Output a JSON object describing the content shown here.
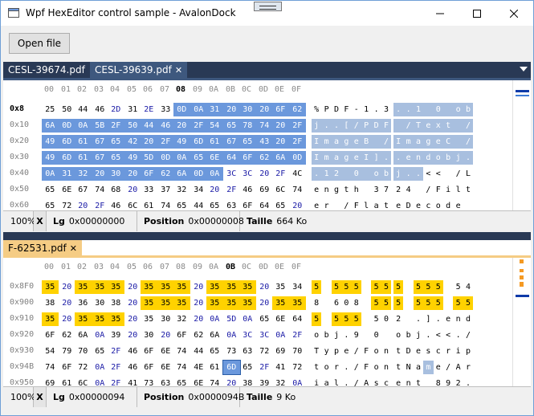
{
  "window": {
    "title": "Wpf HexEditor control sample - AvalonDock"
  },
  "toolbar": {
    "open_label": "Open file"
  },
  "top_pane": {
    "tabs": [
      {
        "label": "CESL-39674.pdf",
        "active": false
      },
      {
        "label": "CESL-39639.pdf",
        "active": true,
        "close": "✕"
      }
    ],
    "header_bytes": [
      "00",
      "01",
      "02",
      "03",
      "04",
      "05",
      "06",
      "07",
      "08",
      "09",
      "0A",
      "0B",
      "0C",
      "0D",
      "0E",
      "0F"
    ],
    "highlight_col": 8,
    "rows": [
      {
        "offset": "0x8",
        "bytes": [
          "25",
          "50",
          "44",
          "46",
          "2D",
          "31",
          "2E",
          "33",
          "0D",
          "0A",
          "31",
          "20",
          "30",
          "20",
          "6F",
          "62"
        ],
        "chars": [
          "%",
          "P",
          "D",
          "F",
          "-",
          "1",
          ".",
          "3",
          ".",
          ".",
          "1",
          " ",
          "0",
          " ",
          "o",
          "b"
        ]
      },
      {
        "offset": "0x10",
        "bytes": [
          "6A",
          "0D",
          "0A",
          "5B",
          "2F",
          "50",
          "44",
          "46",
          "20",
          "2F",
          "54",
          "65",
          "78",
          "74",
          "20",
          "2F"
        ],
        "chars": [
          "j",
          ".",
          ".",
          "[",
          "/",
          "P",
          "D",
          "F",
          " ",
          "/",
          "T",
          "e",
          "x",
          "t",
          " ",
          "/"
        ]
      },
      {
        "offset": "0x20",
        "bytes": [
          "49",
          "6D",
          "61",
          "67",
          "65",
          "42",
          "20",
          "2F",
          "49",
          "6D",
          "61",
          "67",
          "65",
          "43",
          "20",
          "2F"
        ],
        "chars": [
          "I",
          "m",
          "a",
          "g",
          "e",
          "B",
          " ",
          "/",
          "I",
          "m",
          "a",
          "g",
          "e",
          "C",
          " ",
          "/"
        ]
      },
      {
        "offset": "0x30",
        "bytes": [
          "49",
          "6D",
          "61",
          "67",
          "65",
          "49",
          "5D",
          "0D",
          "0A",
          "65",
          "6E",
          "64",
          "6F",
          "62",
          "6A",
          "0D"
        ],
        "chars": [
          "I",
          "m",
          "a",
          "g",
          "e",
          "I",
          "]",
          ".",
          ".",
          "e",
          "n",
          "d",
          "o",
          "b",
          "j",
          "."
        ]
      },
      {
        "offset": "0x40",
        "bytes": [
          "0A",
          "31",
          "32",
          "20",
          "30",
          "20",
          "6F",
          "62",
          "6A",
          "0D",
          "0A",
          "3C",
          "3C",
          "20",
          "2F",
          "4C"
        ],
        "chars": [
          ".",
          "1",
          "2",
          " ",
          "0",
          " ",
          "o",
          "b",
          "j",
          ".",
          ".",
          "<",
          "<",
          " ",
          "/",
          "L"
        ]
      },
      {
        "offset": "0x50",
        "bytes": [
          "65",
          "6E",
          "67",
          "74",
          "68",
          "20",
          "33",
          "37",
          "32",
          "34",
          "20",
          "2F",
          "46",
          "69",
          "6C",
          "74"
        ],
        "chars": [
          "e",
          "n",
          "g",
          "t",
          "h",
          " ",
          "3",
          "7",
          "2",
          "4",
          " ",
          "/",
          "F",
          "i",
          "l",
          "t"
        ]
      },
      {
        "offset": "0x60",
        "bytes": [
          "65",
          "72",
          "20",
          "2F",
          "46",
          "6C",
          "61",
          "74",
          "65",
          "44",
          "65",
          "63",
          "6F",
          "64",
          "65",
          "20"
        ],
        "chars": [
          "e",
          "r",
          " ",
          "/",
          "F",
          "l",
          "a",
          "t",
          "e",
          "D",
          "e",
          "c",
          "o",
          "d",
          "e",
          " "
        ]
      }
    ],
    "status": {
      "zoom": "100%",
      "x": "X",
      "lg_label": "Lg",
      "lg_value": "0x00000000",
      "pos_label": "Position",
      "pos_value": "0x00000008",
      "size_label": "Taille",
      "size_value": "664 Ko"
    }
  },
  "bottom_pane": {
    "tabs": [
      {
        "label": "F-62531.pdf",
        "active": true,
        "close": "✕"
      }
    ],
    "header_bytes": [
      "00",
      "01",
      "02",
      "03",
      "04",
      "05",
      "06",
      "07",
      "08",
      "09",
      "0A",
      "0B",
      "0C",
      "0D",
      "0E",
      "0F"
    ],
    "highlight_col": 11,
    "rows": [
      {
        "offset": "0x8F0",
        "bytes": [
          "35",
          "20",
          "35",
          "35",
          "35",
          "20",
          "35",
          "35",
          "35",
          "20",
          "35",
          "35",
          "35",
          "20",
          "35",
          "34"
        ],
        "chars": [
          "5",
          " ",
          "5",
          "5",
          "5",
          " ",
          "5",
          "5",
          "5",
          " ",
          "5",
          "5",
          "5",
          " ",
          "5",
          "4"
        ]
      },
      {
        "offset": "0x900",
        "bytes": [
          "38",
          "20",
          "36",
          "30",
          "38",
          "20",
          "35",
          "35",
          "35",
          "20",
          "35",
          "35",
          "35",
          "20",
          "35",
          "35"
        ],
        "chars": [
          "8",
          " ",
          "6",
          "0",
          "8",
          " ",
          "5",
          "5",
          "5",
          " ",
          "5",
          "5",
          "5",
          " ",
          "5",
          "5"
        ]
      },
      {
        "offset": "0x910",
        "bytes": [
          "35",
          "20",
          "35",
          "35",
          "35",
          "20",
          "35",
          "30",
          "32",
          "20",
          "0A",
          "5D",
          "0A",
          "65",
          "6E",
          "64"
        ],
        "chars": [
          "5",
          " ",
          "5",
          "5",
          "5",
          " ",
          "5",
          "0",
          "2",
          " ",
          ".",
          "]",
          ".",
          "e",
          "n",
          "d"
        ]
      },
      {
        "offset": "0x920",
        "bytes": [
          "6F",
          "62",
          "6A",
          "0A",
          "39",
          "20",
          "30",
          "20",
          "6F",
          "62",
          "6A",
          "0A",
          "3C",
          "3C",
          "0A",
          "2F"
        ],
        "chars": [
          "o",
          "b",
          "j",
          ".",
          "9",
          " ",
          "0",
          " ",
          "o",
          "b",
          "j",
          ".",
          "<",
          "<",
          ".",
          "/"
        ]
      },
      {
        "offset": "0x930",
        "bytes": [
          "54",
          "79",
          "70",
          "65",
          "2F",
          "46",
          "6F",
          "6E",
          "74",
          "44",
          "65",
          "73",
          "63",
          "72",
          "69",
          "70"
        ],
        "chars": [
          "T",
          "y",
          "p",
          "e",
          "/",
          "F",
          "o",
          "n",
          "t",
          "D",
          "e",
          "s",
          "c",
          "r",
          "i",
          "p"
        ]
      },
      {
        "offset": "0x94B",
        "bytes": [
          "74",
          "6F",
          "72",
          "0A",
          "2F",
          "46",
          "6F",
          "6E",
          "74",
          "4E",
          "61",
          "6D",
          "65",
          "2F",
          "41",
          "72"
        ],
        "chars": [
          "t",
          "o",
          "r",
          ".",
          "/",
          "F",
          "o",
          "n",
          "t",
          "N",
          "a",
          "m",
          "e",
          "/",
          "A",
          "r"
        ]
      },
      {
        "offset": "0x950",
        "bytes": [
          "69",
          "61",
          "6C",
          "0A",
          "2F",
          "41",
          "73",
          "63",
          "65",
          "6E",
          "74",
          "20",
          "38",
          "39",
          "32",
          "0A"
        ],
        "chars": [
          "i",
          "a",
          "l",
          ".",
          "/",
          "A",
          "s",
          "c",
          "e",
          "n",
          "t",
          " ",
          "8",
          "9",
          "2",
          "."
        ]
      }
    ],
    "status": {
      "zoom": "100%",
      "x": "X",
      "lg_label": "Lg",
      "lg_value": "0x00000094",
      "pos_label": "Position",
      "pos_value": "0x0000094B",
      "size_label": "Taille",
      "size_value": "9 Ko"
    }
  },
  "colors": {
    "tab_strip": "#293955",
    "active_tab": "#3e587e",
    "selected_bytes": "#6b98dc",
    "highlight_bytes": "#ffd200",
    "doc_tab_gold": "#f5cc84"
  },
  "icons": {
    "app": "hexeditor-app-icon",
    "minimize": "minimize-icon",
    "maximize": "maximize-icon",
    "close": "close-icon"
  }
}
